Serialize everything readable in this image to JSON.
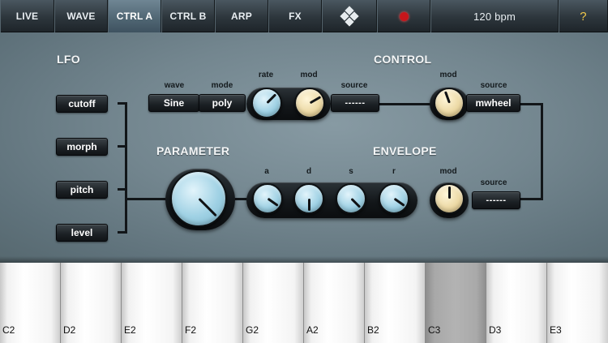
{
  "nav": {
    "tabs": [
      {
        "label": "LIVE"
      },
      {
        "label": "WAVE"
      },
      {
        "label": "CTRL A",
        "active": true
      },
      {
        "label": "CTRL B"
      },
      {
        "label": "ARP"
      },
      {
        "label": "FX"
      }
    ],
    "logo_icon": "diamond-logo-icon",
    "record_icon": "record-dot-icon",
    "record_color": "#c6161b",
    "tempo": "120 bpm",
    "help": "?"
  },
  "lfo": {
    "title": "LFO",
    "targets": [
      "cutoff",
      "morph",
      "pitch",
      "level"
    ],
    "wave_label": "wave",
    "wave_value": "Sine",
    "mode_label": "mode",
    "mode_value": "poly",
    "rate_label": "rate",
    "mod_label": "mod",
    "source_label": "source",
    "source_value": "------"
  },
  "control": {
    "title": "CONTROL",
    "mod_label": "mod",
    "source_label": "source",
    "source_value": "mwheel"
  },
  "parameter": {
    "title": "PARAMETER"
  },
  "envelope": {
    "title": "ENVELOPE",
    "a_label": "a",
    "d_label": "d",
    "s_label": "s",
    "r_label": "r",
    "mod_label": "mod",
    "source_label": "source",
    "source_value": "------"
  },
  "keyboard": {
    "keys": [
      "C2",
      "D2",
      "E2",
      "F2",
      "G2",
      "A2",
      "B2",
      "C3",
      "D3",
      "E3"
    ],
    "pressed": "C3"
  }
}
